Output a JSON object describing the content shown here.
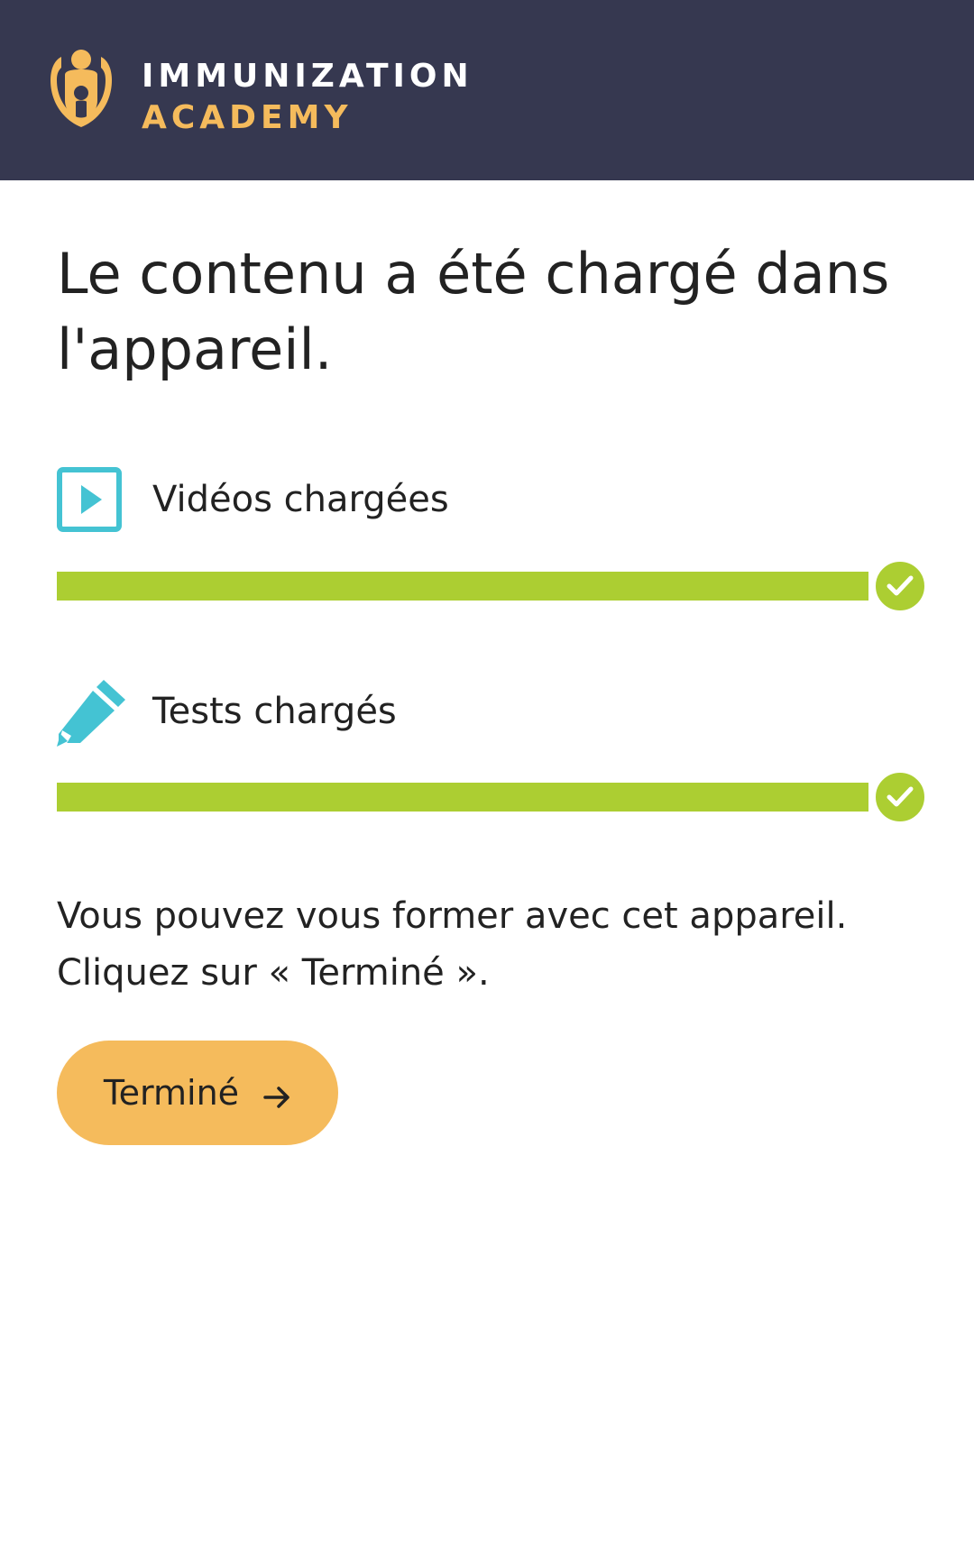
{
  "header": {
    "brand_line1": "IMMUNIZATION",
    "brand_line2": "ACADEMY",
    "logo_icon": "family-logo-icon"
  },
  "main": {
    "title": "Le contenu a été chargé dans l'appareil.",
    "items": [
      {
        "label": "Vidéos chargées",
        "icon": "video-play-icon",
        "progress": 1.0,
        "status_icon": "check-icon"
      },
      {
        "label": "Tests chargés",
        "icon": "pencil-icon",
        "progress": 1.0,
        "status_icon": "check-icon"
      }
    ],
    "message_line1": "Vous pouvez vous former avec cet appareil.",
    "message_line2": "Cliquez sur « Terminé ».",
    "done_button_label": "Terminé",
    "done_button_icon": "arrow-right-icon"
  },
  "colors": {
    "header_bg": "#363850",
    "brand_accent": "#f5bb5c",
    "progress": "#acce32",
    "icon_accent": "#44c3d3",
    "button_bg": "#f5bb5c"
  }
}
